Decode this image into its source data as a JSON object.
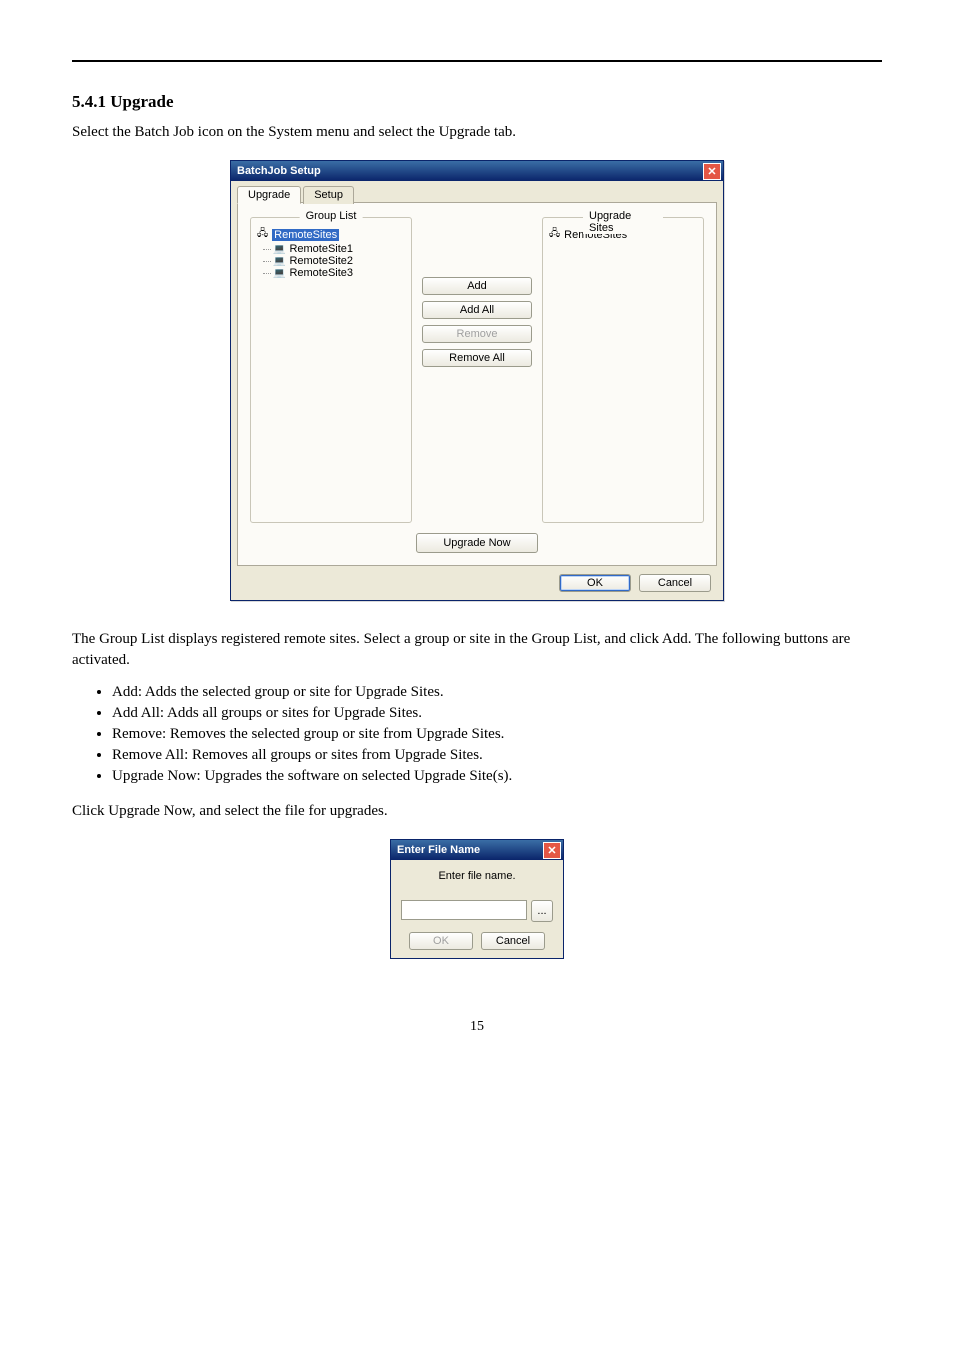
{
  "header_rule": true,
  "section_title": "5.4.1 Upgrade",
  "intro_paragraph": "Select the Batch Job icon on the System menu and select the Upgrade tab.",
  "tabs_paragraph": "The Group List displays registered remote sites. Select a group or site in the Group List, and click Add. The following buttons are activated.",
  "bullets": [
    "Add: Adds the selected group or site for Upgrade Sites.",
    "Add All: Adds all groups or sites for Upgrade Sites.",
    "Remove: Removes the selected group or site from Upgrade Sites.",
    "Remove All: Removes all groups or sites from Upgrade Sites.",
    "Upgrade Now: Upgrades the software on selected Upgrade Site(s)."
  ],
  "mini_dialog_paragraph": "Click Upgrade Now, and select the file for upgrades.",
  "page_number": "15",
  "batchjob_window": {
    "title": "BatchJob Setup",
    "tabs": {
      "upgrade": "Upgrade",
      "setup": "Setup"
    },
    "group_list_label": "Group List",
    "upgrade_sites_label": "Upgrade Sites",
    "group_tree": {
      "root": "RemoteSites",
      "children": [
        "RemoteSite1",
        "RemoteSite2",
        "RemoteSite3"
      ]
    },
    "upgrade_tree_root": "RemoteSites",
    "buttons": {
      "add": "Add",
      "add_all": "Add All",
      "remove": "Remove",
      "remove_all": "Remove All",
      "upgrade_now": "Upgrade Now",
      "ok": "OK",
      "cancel": "Cancel"
    }
  },
  "file_dialog": {
    "title": "Enter File Name",
    "label": "Enter file name.",
    "browse_glyph": "...",
    "ok": "OK",
    "cancel": "Cancel"
  }
}
